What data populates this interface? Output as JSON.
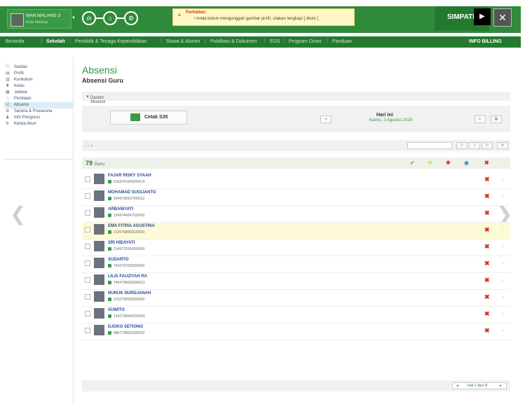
{
  "header": {
    "school_name": "MAN MALANG 3",
    "school_city": "Kota Malang",
    "alert_title": "Perhatian:",
    "alert_message": "• Anda belum mengunggah gambar profil, silakan lengkapi [ disini ]",
    "brand": "SIMPATIKA"
  },
  "menu": {
    "items": [
      "Beranda",
      "Sekolah",
      "Pendidik & Tenaga Kependidikan",
      "Siswa & Alumni",
      "Publikasi & Dokumen",
      "EDS",
      "Program Dinas",
      "Panduan"
    ],
    "billing": "INFO BILLING"
  },
  "sidebar": {
    "items": [
      "Sekilas",
      "Profil",
      "Kurikulum",
      "Kelas",
      "Jadwal",
      "Penilaian",
      "Absensi",
      "Sarana & Prasarana",
      "Info Pengurus",
      "Kelola Akun"
    ]
  },
  "page": {
    "title": "Absensi",
    "subtitle": "Absensi Guru",
    "breadcrumb": "Dasbor Absensi",
    "print_button": "Cetak S35",
    "today_label": "Hari ini",
    "today_date": "Kamis, 2 Agustus 2018",
    "count": "79",
    "count_label": "Guru",
    "pager": "Hal 1 dari 8"
  },
  "teachers": [
    {
      "name": "FAJAR RISKY SYAAH",
      "nip": "6163741644200014"
    },
    {
      "name": "MOHAMAD SUGIJANTO",
      "nip": "9549735637200012"
    },
    {
      "name": "ARBANIYATI",
      "nip": "1549746647220002"
    },
    {
      "name": "EMA FITRIA AGUSTINA",
      "nip": "2135758659220003"
    },
    {
      "name": "SRI HIDAYATI",
      "nip": "2149732634300043"
    },
    {
      "name": "SUDARTO",
      "nip": "7542737639200042"
    },
    {
      "name": "LILIS FAUZIYAH RA",
      "nip": "7454738639300023"
    },
    {
      "name": "NUNUK NURDJANAH",
      "nip": "3752738638300002"
    },
    {
      "name": "SUWITO",
      "nip": "1342738640200003"
    },
    {
      "name": "DJOKO SETIONO",
      "nip": "4857738641200032"
    }
  ],
  "icons": {
    "header": [
      "chart-icon",
      "school-icon",
      "gear-icon"
    ],
    "status": [
      "check-icon",
      "mail-icon",
      "plus-icon",
      "clock-icon",
      "close-icon"
    ]
  },
  "colors": {
    "primary": "#2f8b3a",
    "dark": "#237a2f",
    "danger": "#d0302a"
  }
}
